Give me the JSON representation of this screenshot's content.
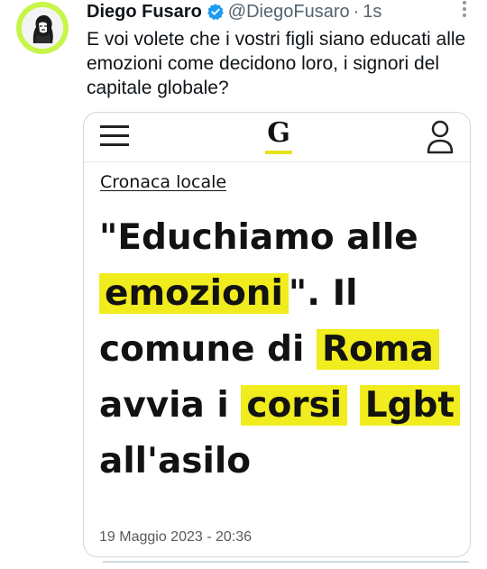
{
  "tweet": {
    "author_name": "Diego Fusaro",
    "handle": "@DiegoFusaro",
    "separator": "·",
    "time": "1s",
    "text": "E voi volete che i vostri figli siano educati alle emozioni come decidono loro, i signori del capitale globale?"
  },
  "card": {
    "logo_letter": "G",
    "section": "Cronaca locale",
    "headline": {
      "part1": "\"Educhiamo alle",
      "hl1": "emozioni",
      "part2": "\". Il comune di",
      "hl2": "Roma",
      "part3": "avvia i",
      "hl3": "corsi",
      "hl4": "Lgbt",
      "part4": "all'asilo"
    },
    "date": "19 Maggio 2023 - 20:36"
  },
  "colors": {
    "highlight": "#f0ec1e",
    "avatar_ring": "#c8f54a",
    "verified": "#1d9bf0",
    "muted_text": "#536471"
  },
  "icons": [
    "avatar",
    "verified-badge-icon",
    "more-icon",
    "hamburger-menu-icon",
    "account-icon"
  ]
}
